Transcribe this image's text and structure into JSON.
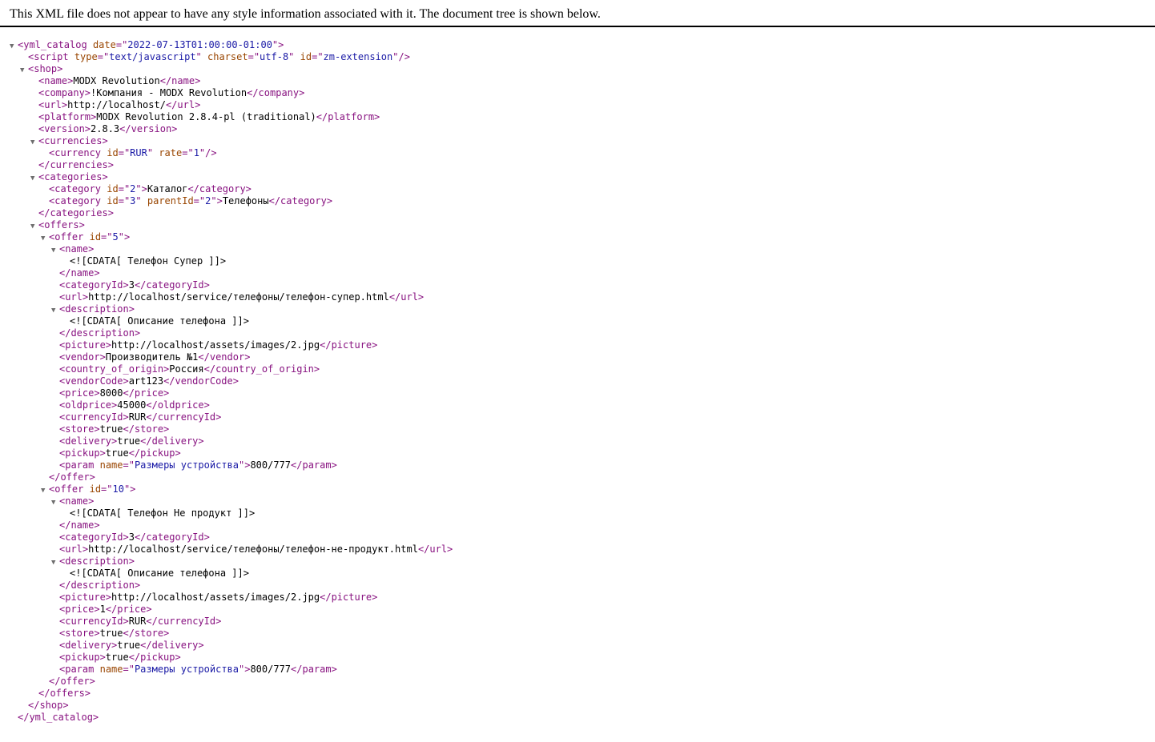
{
  "header": {
    "message": "This XML file does not appear to have any style information associated with it. The document tree is shown below."
  },
  "colors": {
    "tag": "#881280",
    "attribute_name": "#994500",
    "attribute_value": "#1a1aa6",
    "text": "#000000",
    "toggle": "#6e6e6e"
  },
  "icons": {
    "expanded": "triangle-down-icon"
  },
  "lines": [
    {
      "depth": 0,
      "toggle": true,
      "parts": [
        [
          "tag",
          "<yml_catalog"
        ],
        [
          "txt",
          " "
        ],
        [
          "attr",
          "date"
        ],
        [
          "tag",
          "=\""
        ],
        [
          "aval",
          "2022-07-13T01:00:00-01:00"
        ],
        [
          "tag",
          "\">"
        ]
      ]
    },
    {
      "depth": 1,
      "toggle": false,
      "parts": [
        [
          "tag",
          "<script"
        ],
        [
          "txt",
          " "
        ],
        [
          "attr",
          "type"
        ],
        [
          "tag",
          "=\""
        ],
        [
          "aval",
          "text/javascript"
        ],
        [
          "tag",
          "\""
        ],
        [
          "txt",
          " "
        ],
        [
          "attr",
          "charset"
        ],
        [
          "tag",
          "=\""
        ],
        [
          "aval",
          "utf-8"
        ],
        [
          "tag",
          "\""
        ],
        [
          "txt",
          " "
        ],
        [
          "attr",
          "id"
        ],
        [
          "tag",
          "=\""
        ],
        [
          "aval",
          "zm-extension"
        ],
        [
          "tag",
          "\"/>"
        ]
      ]
    },
    {
      "depth": 1,
      "toggle": true,
      "parts": [
        [
          "tag",
          "<shop>"
        ]
      ]
    },
    {
      "depth": 2,
      "toggle": false,
      "parts": [
        [
          "tag",
          "<name>"
        ],
        [
          "txt",
          "MODX Revolution"
        ],
        [
          "tag",
          "</name>"
        ]
      ]
    },
    {
      "depth": 2,
      "toggle": false,
      "parts": [
        [
          "tag",
          "<company>"
        ],
        [
          "txt",
          "!Компания - MODX Revolution"
        ],
        [
          "tag",
          "</company>"
        ]
      ]
    },
    {
      "depth": 2,
      "toggle": false,
      "parts": [
        [
          "tag",
          "<url>"
        ],
        [
          "txt",
          "http://localhost/"
        ],
        [
          "tag",
          "</url>"
        ]
      ]
    },
    {
      "depth": 2,
      "toggle": false,
      "parts": [
        [
          "tag",
          "<platform>"
        ],
        [
          "txt",
          "MODX Revolution 2.8.4-pl (traditional)"
        ],
        [
          "tag",
          "</platform>"
        ]
      ]
    },
    {
      "depth": 2,
      "toggle": false,
      "parts": [
        [
          "tag",
          "<version>"
        ],
        [
          "txt",
          "2.8.3"
        ],
        [
          "tag",
          "</version>"
        ]
      ]
    },
    {
      "depth": 2,
      "toggle": true,
      "parts": [
        [
          "tag",
          "<currencies>"
        ]
      ]
    },
    {
      "depth": 3,
      "toggle": false,
      "parts": [
        [
          "tag",
          "<currency"
        ],
        [
          "txt",
          " "
        ],
        [
          "attr",
          "id"
        ],
        [
          "tag",
          "=\""
        ],
        [
          "aval",
          "RUR"
        ],
        [
          "tag",
          "\""
        ],
        [
          "txt",
          " "
        ],
        [
          "attr",
          "rate"
        ],
        [
          "tag",
          "=\""
        ],
        [
          "aval",
          "1"
        ],
        [
          "tag",
          "\"/>"
        ]
      ]
    },
    {
      "depth": 2,
      "toggle": false,
      "parts": [
        [
          "tag",
          "</currencies>"
        ]
      ]
    },
    {
      "depth": 2,
      "toggle": true,
      "parts": [
        [
          "tag",
          "<categories>"
        ]
      ]
    },
    {
      "depth": 3,
      "toggle": false,
      "parts": [
        [
          "tag",
          "<category"
        ],
        [
          "txt",
          " "
        ],
        [
          "attr",
          "id"
        ],
        [
          "tag",
          "=\""
        ],
        [
          "aval",
          "2"
        ],
        [
          "tag",
          "\">"
        ],
        [
          "txt",
          "Каталог"
        ],
        [
          "tag",
          "</category>"
        ]
      ]
    },
    {
      "depth": 3,
      "toggle": false,
      "parts": [
        [
          "tag",
          "<category"
        ],
        [
          "txt",
          " "
        ],
        [
          "attr",
          "id"
        ],
        [
          "tag",
          "=\""
        ],
        [
          "aval",
          "3"
        ],
        [
          "tag",
          "\""
        ],
        [
          "txt",
          " "
        ],
        [
          "attr",
          "parentId"
        ],
        [
          "tag",
          "=\""
        ],
        [
          "aval",
          "2"
        ],
        [
          "tag",
          "\">"
        ],
        [
          "txt",
          "Телефоны"
        ],
        [
          "tag",
          "</category>"
        ]
      ]
    },
    {
      "depth": 2,
      "toggle": false,
      "parts": [
        [
          "tag",
          "</categories>"
        ]
      ]
    },
    {
      "depth": 2,
      "toggle": true,
      "parts": [
        [
          "tag",
          "<offers>"
        ]
      ]
    },
    {
      "depth": 3,
      "toggle": true,
      "parts": [
        [
          "tag",
          "<offer"
        ],
        [
          "txt",
          " "
        ],
        [
          "attr",
          "id"
        ],
        [
          "tag",
          "=\""
        ],
        [
          "aval",
          "5"
        ],
        [
          "tag",
          "\">"
        ]
      ]
    },
    {
      "depth": 4,
      "toggle": true,
      "parts": [
        [
          "tag",
          "<name>"
        ]
      ]
    },
    {
      "depth": 5,
      "toggle": false,
      "parts": [
        [
          "txt",
          "<![CDATA[ Телефон Супер ]]>"
        ]
      ]
    },
    {
      "depth": 4,
      "toggle": false,
      "parts": [
        [
          "tag",
          "</name>"
        ]
      ]
    },
    {
      "depth": 4,
      "toggle": false,
      "parts": [
        [
          "tag",
          "<categoryId>"
        ],
        [
          "txt",
          "3"
        ],
        [
          "tag",
          "</categoryId>"
        ]
      ]
    },
    {
      "depth": 4,
      "toggle": false,
      "parts": [
        [
          "tag",
          "<url>"
        ],
        [
          "txt",
          "http://localhost/service/телефоны/телефон-супер.html"
        ],
        [
          "tag",
          "</url>"
        ]
      ]
    },
    {
      "depth": 4,
      "toggle": true,
      "parts": [
        [
          "tag",
          "<description>"
        ]
      ]
    },
    {
      "depth": 5,
      "toggle": false,
      "parts": [
        [
          "txt",
          "<![CDATA[ Описание телефона ]]>"
        ]
      ]
    },
    {
      "depth": 4,
      "toggle": false,
      "parts": [
        [
          "tag",
          "</description>"
        ]
      ]
    },
    {
      "depth": 4,
      "toggle": false,
      "parts": [
        [
          "tag",
          "<picture>"
        ],
        [
          "txt",
          "http://localhost/assets/images/2.jpg"
        ],
        [
          "tag",
          "</picture>"
        ]
      ]
    },
    {
      "depth": 4,
      "toggle": false,
      "parts": [
        [
          "tag",
          "<vendor>"
        ],
        [
          "txt",
          "Производитель №1"
        ],
        [
          "tag",
          "</vendor>"
        ]
      ]
    },
    {
      "depth": 4,
      "toggle": false,
      "parts": [
        [
          "tag",
          "<country_of_origin>"
        ],
        [
          "txt",
          "Россия"
        ],
        [
          "tag",
          "</country_of_origin>"
        ]
      ]
    },
    {
      "depth": 4,
      "toggle": false,
      "parts": [
        [
          "tag",
          "<vendorCode>"
        ],
        [
          "txt",
          "art123"
        ],
        [
          "tag",
          "</vendorCode>"
        ]
      ]
    },
    {
      "depth": 4,
      "toggle": false,
      "parts": [
        [
          "tag",
          "<price>"
        ],
        [
          "txt",
          "8000"
        ],
        [
          "tag",
          "</price>"
        ]
      ]
    },
    {
      "depth": 4,
      "toggle": false,
      "parts": [
        [
          "tag",
          "<oldprice>"
        ],
        [
          "txt",
          "45000"
        ],
        [
          "tag",
          "</oldprice>"
        ]
      ]
    },
    {
      "depth": 4,
      "toggle": false,
      "parts": [
        [
          "tag",
          "<currencyId>"
        ],
        [
          "txt",
          "RUR"
        ],
        [
          "tag",
          "</currencyId>"
        ]
      ]
    },
    {
      "depth": 4,
      "toggle": false,
      "parts": [
        [
          "tag",
          "<store>"
        ],
        [
          "txt",
          "true"
        ],
        [
          "tag",
          "</store>"
        ]
      ]
    },
    {
      "depth": 4,
      "toggle": false,
      "parts": [
        [
          "tag",
          "<delivery>"
        ],
        [
          "txt",
          "true"
        ],
        [
          "tag",
          "</delivery>"
        ]
      ]
    },
    {
      "depth": 4,
      "toggle": false,
      "parts": [
        [
          "tag",
          "<pickup>"
        ],
        [
          "txt",
          "true"
        ],
        [
          "tag",
          "</pickup>"
        ]
      ]
    },
    {
      "depth": 4,
      "toggle": false,
      "parts": [
        [
          "tag",
          "<param"
        ],
        [
          "txt",
          " "
        ],
        [
          "attr",
          "name"
        ],
        [
          "tag",
          "=\""
        ],
        [
          "aval",
          "Размеры устройства"
        ],
        [
          "tag",
          "\">"
        ],
        [
          "txt",
          "800/777"
        ],
        [
          "tag",
          "</param>"
        ]
      ]
    },
    {
      "depth": 3,
      "toggle": false,
      "parts": [
        [
          "tag",
          "</offer>"
        ]
      ]
    },
    {
      "depth": 3,
      "toggle": true,
      "parts": [
        [
          "tag",
          "<offer"
        ],
        [
          "txt",
          " "
        ],
        [
          "attr",
          "id"
        ],
        [
          "tag",
          "=\""
        ],
        [
          "aval",
          "10"
        ],
        [
          "tag",
          "\">"
        ]
      ]
    },
    {
      "depth": 4,
      "toggle": true,
      "parts": [
        [
          "tag",
          "<name>"
        ]
      ]
    },
    {
      "depth": 5,
      "toggle": false,
      "parts": [
        [
          "txt",
          "<![CDATA[ Телефон Не продукт ]]>"
        ]
      ]
    },
    {
      "depth": 4,
      "toggle": false,
      "parts": [
        [
          "tag",
          "</name>"
        ]
      ]
    },
    {
      "depth": 4,
      "toggle": false,
      "parts": [
        [
          "tag",
          "<categoryId>"
        ],
        [
          "txt",
          "3"
        ],
        [
          "tag",
          "</categoryId>"
        ]
      ]
    },
    {
      "depth": 4,
      "toggle": false,
      "parts": [
        [
          "tag",
          "<url>"
        ],
        [
          "txt",
          "http://localhost/service/телефоны/телефон-не-продукт.html"
        ],
        [
          "tag",
          "</url>"
        ]
      ]
    },
    {
      "depth": 4,
      "toggle": true,
      "parts": [
        [
          "tag",
          "<description>"
        ]
      ]
    },
    {
      "depth": 5,
      "toggle": false,
      "parts": [
        [
          "txt",
          "<![CDATA[ Описание телефона ]]>"
        ]
      ]
    },
    {
      "depth": 4,
      "toggle": false,
      "parts": [
        [
          "tag",
          "</description>"
        ]
      ]
    },
    {
      "depth": 4,
      "toggle": false,
      "parts": [
        [
          "tag",
          "<picture>"
        ],
        [
          "txt",
          "http://localhost/assets/images/2.jpg"
        ],
        [
          "tag",
          "</picture>"
        ]
      ]
    },
    {
      "depth": 4,
      "toggle": false,
      "parts": [
        [
          "tag",
          "<price>"
        ],
        [
          "txt",
          "1"
        ],
        [
          "tag",
          "</price>"
        ]
      ]
    },
    {
      "depth": 4,
      "toggle": false,
      "parts": [
        [
          "tag",
          "<currencyId>"
        ],
        [
          "txt",
          "RUR"
        ],
        [
          "tag",
          "</currencyId>"
        ]
      ]
    },
    {
      "depth": 4,
      "toggle": false,
      "parts": [
        [
          "tag",
          "<store>"
        ],
        [
          "txt",
          "true"
        ],
        [
          "tag",
          "</store>"
        ]
      ]
    },
    {
      "depth": 4,
      "toggle": false,
      "parts": [
        [
          "tag",
          "<delivery>"
        ],
        [
          "txt",
          "true"
        ],
        [
          "tag",
          "</delivery>"
        ]
      ]
    },
    {
      "depth": 4,
      "toggle": false,
      "parts": [
        [
          "tag",
          "<pickup>"
        ],
        [
          "txt",
          "true"
        ],
        [
          "tag",
          "</pickup>"
        ]
      ]
    },
    {
      "depth": 4,
      "toggle": false,
      "parts": [
        [
          "tag",
          "<param"
        ],
        [
          "txt",
          " "
        ],
        [
          "attr",
          "name"
        ],
        [
          "tag",
          "=\""
        ],
        [
          "aval",
          "Размеры устройства"
        ],
        [
          "tag",
          "\">"
        ],
        [
          "txt",
          "800/777"
        ],
        [
          "tag",
          "</param>"
        ]
      ]
    },
    {
      "depth": 3,
      "toggle": false,
      "parts": [
        [
          "tag",
          "</offer>"
        ]
      ]
    },
    {
      "depth": 2,
      "toggle": false,
      "parts": [
        [
          "tag",
          "</offers>"
        ]
      ]
    },
    {
      "depth": 1,
      "toggle": false,
      "parts": [
        [
          "tag",
          "</shop>"
        ]
      ]
    },
    {
      "depth": 0,
      "toggle": false,
      "parts": [
        [
          "tag",
          "</yml_catalog>"
        ]
      ]
    }
  ]
}
